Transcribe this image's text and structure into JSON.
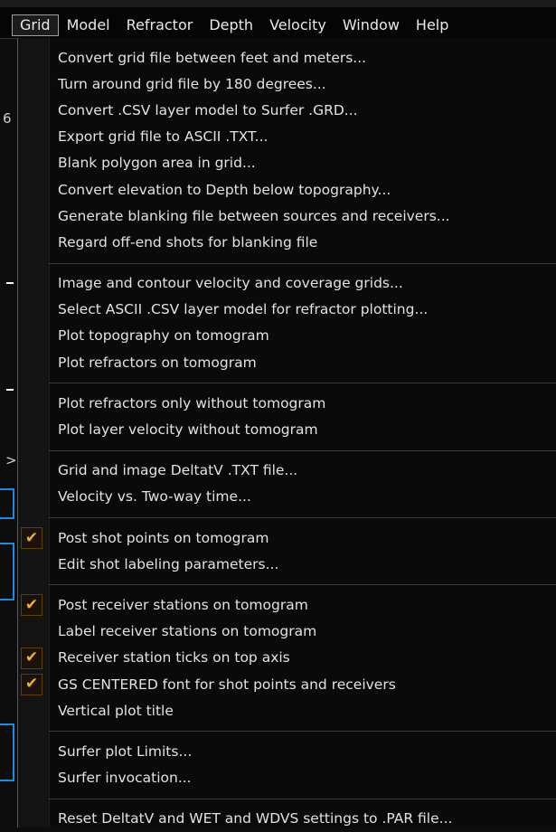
{
  "menubar": {
    "items": [
      {
        "label": "Grid",
        "active": true
      },
      {
        "label": "Model",
        "active": false
      },
      {
        "label": "Refractor",
        "active": false
      },
      {
        "label": "Depth",
        "active": false
      },
      {
        "label": "Velocity",
        "active": false
      },
      {
        "label": "Window",
        "active": false
      },
      {
        "label": "Help",
        "active": false
      }
    ]
  },
  "background": {
    "fragment_6": "6",
    "fragment_gt": ">"
  },
  "colors": {
    "check": "#f2b21f",
    "accent_blue": "#1e88e5"
  },
  "grid_menu": {
    "groups": [
      {
        "items": [
          {
            "label": "Convert grid file between feet and meters...",
            "checked": false
          },
          {
            "label": "Turn around grid file by 180 degrees...",
            "checked": false
          },
          {
            "label": "Convert .CSV layer model to Surfer .GRD...",
            "checked": false
          },
          {
            "label": "Export grid file to ASCII .TXT...",
            "checked": false
          },
          {
            "label": "Blank polygon area in grid...",
            "checked": false
          },
          {
            "label": "Convert elevation to Depth below topography...",
            "checked": false
          },
          {
            "label": "Generate blanking file between sources and receivers...",
            "checked": false
          },
          {
            "label": "Regard off-end shots for blanking file",
            "checked": false
          }
        ]
      },
      {
        "items": [
          {
            "label": "Image and contour velocity and coverage grids...",
            "checked": false
          },
          {
            "label": "Select ASCII .CSV layer model for refractor plotting...",
            "checked": false
          },
          {
            "label": "Plot topography on tomogram",
            "checked": false
          },
          {
            "label": "Plot refractors on tomogram",
            "checked": false
          }
        ]
      },
      {
        "items": [
          {
            "label": "Plot refractors only without tomogram",
            "checked": false
          },
          {
            "label": "Plot layer velocity without tomogram",
            "checked": false
          }
        ]
      },
      {
        "items": [
          {
            "label": "Grid and image DeltatV .TXT file...",
            "checked": false
          },
          {
            "label": "Velocity vs. Two-way time...",
            "checked": false
          }
        ]
      },
      {
        "items": [
          {
            "label": "Post shot points on tomogram",
            "checked": true
          },
          {
            "label": "Edit shot labeling parameters...",
            "checked": false
          }
        ]
      },
      {
        "items": [
          {
            "label": "Post receiver stations on tomogram",
            "checked": true
          },
          {
            "label": "Label receiver stations on tomogram",
            "checked": false
          },
          {
            "label": "Receiver station ticks on top axis",
            "checked": true
          },
          {
            "label": "GS CENTERED font for shot points and receivers",
            "checked": true
          },
          {
            "label": "Vertical plot title",
            "checked": false
          }
        ]
      },
      {
        "items": [
          {
            "label": "Surfer plot Limits...",
            "checked": false
          },
          {
            "label": "Surfer invocation...",
            "checked": false
          }
        ]
      },
      {
        "items": [
          {
            "label": "Reset DeltatV and WET and WDVS settings to .PAR file...",
            "checked": false
          }
        ]
      }
    ]
  }
}
